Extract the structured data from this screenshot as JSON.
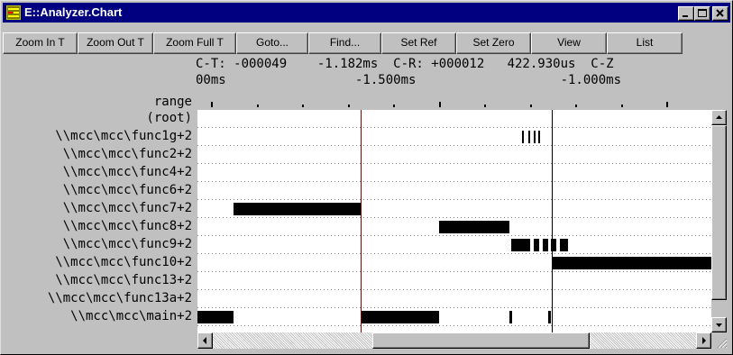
{
  "window": {
    "title": "E::Analyzer.Chart",
    "controls": [
      "minimize",
      "maximize",
      "close"
    ]
  },
  "toolbar": {
    "buttons": [
      "Zoom In T",
      "Zoom Out T",
      "Zoom Full T",
      "Goto...",
      "Find...",
      "Set Ref",
      "Set Zero",
      "View",
      "List"
    ]
  },
  "info": {
    "line1": "C-T: -000049    -1.182ms  C-R: +000012   422.930us  C-Z",
    "line2": "00ms                 -1.500ms                   -1.000ms"
  },
  "range_label": "range",
  "rows": [
    {
      "label": "(root)",
      "bars": []
    },
    {
      "label": "\\\\mcc\\mcc\\func1g+2",
      "bars": [
        [
          0.632,
          0.635
        ],
        [
          0.643,
          0.646
        ],
        [
          0.654,
          0.657
        ],
        [
          0.664,
          0.667
        ]
      ]
    },
    {
      "label": "\\\\mcc\\mcc\\func2+2",
      "bars": []
    },
    {
      "label": "\\\\mcc\\mcc\\func4+2",
      "bars": []
    },
    {
      "label": "\\\\mcc\\mcc\\func6+2",
      "bars": []
    },
    {
      "label": "\\\\mcc\\mcc\\func7+2",
      "bars": [
        [
          0.07,
          0.317
        ]
      ]
    },
    {
      "label": "\\\\mcc\\mcc\\func8+2",
      "bars": [
        [
          0.47,
          0.606
        ]
      ]
    },
    {
      "label": "\\\\mcc\\mcc\\func9+2",
      "bars": [
        [
          0.611,
          0.648
        ],
        [
          0.655,
          0.665
        ],
        [
          0.672,
          0.682
        ],
        [
          0.688,
          0.698
        ],
        [
          0.705,
          0.72
        ]
      ]
    },
    {
      "label": "\\\\mcc\\mcc\\func10+2",
      "bars": [
        [
          0.69,
          1.0
        ]
      ]
    },
    {
      "label": "\\\\mcc\\mcc\\func13+2",
      "bars": []
    },
    {
      "label": "\\\\mcc\\mcc\\func13a+2",
      "bars": []
    },
    {
      "label": "\\\\mcc\\mcc\\main+2",
      "bars": [
        [
          0.0,
          0.07
        ],
        [
          0.317,
          0.47
        ],
        [
          0.607,
          0.613
        ],
        [
          0.682,
          0.688
        ]
      ]
    }
  ],
  "cursors": {
    "trigger": 0.317,
    "reference": 0.69
  },
  "colors": {
    "title_bar": "#000080",
    "trigger_cursor": "#8b0000",
    "reference_cursor": "#000000",
    "bar": "#000000"
  },
  "scroll": {
    "vertical_top": 0.0,
    "horizontal_start": 0.33,
    "horizontal_extent": 0.45
  }
}
